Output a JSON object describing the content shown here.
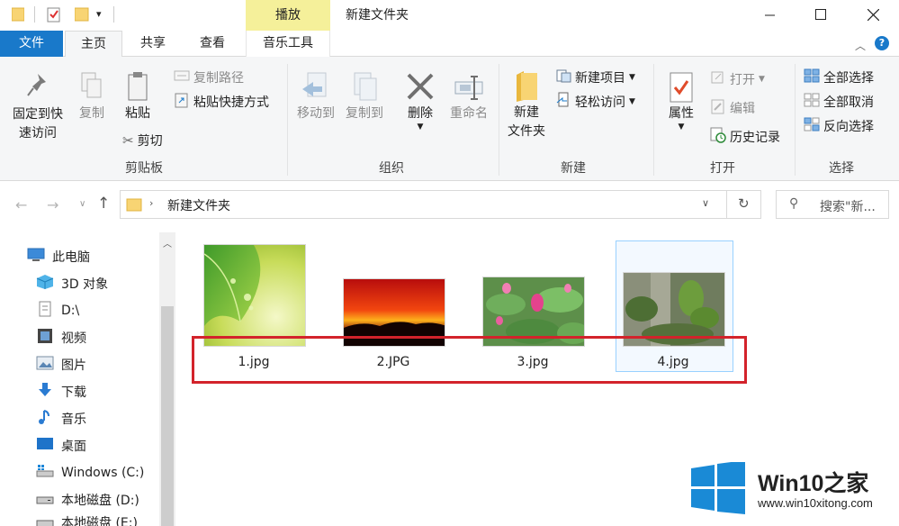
{
  "title_bar": {
    "context_tab": "播放",
    "window_title": "新建文件夹"
  },
  "tabs": {
    "file": "文件",
    "home": "主页",
    "share": "共享",
    "view": "查看",
    "music_tools": "音乐工具"
  },
  "ribbon": {
    "clipboard": {
      "pin_line1": "固定到快",
      "pin_line2": "速访问",
      "copy": "复制",
      "paste": "粘贴",
      "copy_path": "复制路径",
      "paste_shortcut": "粘贴快捷方式",
      "cut": "剪切",
      "label": "剪贴板"
    },
    "organize": {
      "move_to": "移动到",
      "copy_to": "复制到",
      "delete": "删除",
      "rename": "重命名",
      "label": "组织"
    },
    "new": {
      "new_folder_line1": "新建",
      "new_folder_line2": "文件夹",
      "new_item": "新建项目",
      "easy_access": "轻松访问",
      "label": "新建"
    },
    "open": {
      "properties": "属性",
      "open": "打开",
      "edit": "编辑",
      "history": "历史记录",
      "label": "打开"
    },
    "select": {
      "select_all": "全部选择",
      "select_none": "全部取消",
      "invert": "反向选择",
      "label": "选择"
    }
  },
  "address": {
    "path": "新建文件夹",
    "search_placeholder": "搜索\"新..."
  },
  "nav_pane": [
    {
      "label": "此电脑",
      "icon": "computer-icon"
    },
    {
      "label": "3D 对象",
      "icon": "3d-objects-icon"
    },
    {
      "label": "D:\\",
      "icon": "drive-icon"
    },
    {
      "label": "视频",
      "icon": "video-icon"
    },
    {
      "label": "图片",
      "icon": "pictures-icon"
    },
    {
      "label": "下载",
      "icon": "download-icon"
    },
    {
      "label": "音乐",
      "icon": "music-icon"
    },
    {
      "label": "桌面",
      "icon": "desktop-icon"
    },
    {
      "label": "Windows (C:)",
      "icon": "windows-drive-icon"
    },
    {
      "label": "本地磁盘 (D:)",
      "icon": "local-disk-icon"
    },
    {
      "label": "本地磁盘 (E:)",
      "icon": "local-disk-icon"
    }
  ],
  "files": [
    {
      "name": "1.jpg"
    },
    {
      "name": "2.JPG"
    },
    {
      "name": "3.jpg"
    },
    {
      "name": "4.jpg"
    }
  ],
  "watermark": {
    "brand": "Win10之家",
    "url": "www.win10xitong.com"
  },
  "colors": {
    "file_tab": "#1979ca",
    "context_tab": "#f5f09a",
    "highlight_box": "#d3232b",
    "selection": "#99d1ff",
    "win_logo": "#1a8ad6"
  }
}
